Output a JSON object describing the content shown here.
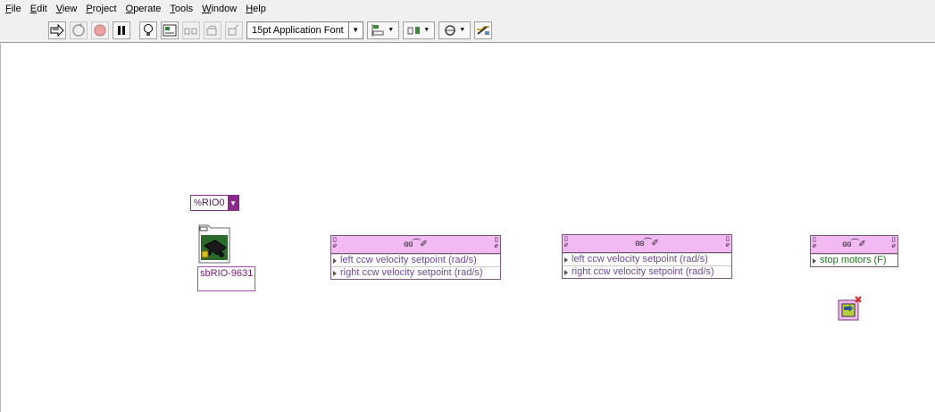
{
  "menu": {
    "items": [
      {
        "label": "File",
        "u": "F",
        "rest": "ile"
      },
      {
        "label": "Edit",
        "u": "E",
        "rest": "dit"
      },
      {
        "label": "View",
        "u": "V",
        "rest": "iew"
      },
      {
        "label": "Project",
        "u": "P",
        "rest": "roject"
      },
      {
        "label": "Operate",
        "u": "O",
        "rest": "perate"
      },
      {
        "label": "Tools",
        "u": "T",
        "rest": "ools"
      },
      {
        "label": "Window",
        "u": "W",
        "rest": "indow"
      },
      {
        "label": "Help",
        "u": "H",
        "rest": "elp"
      }
    ]
  },
  "toolbar": {
    "font_selector": "15pt Application Font"
  },
  "diagram": {
    "resource_control": {
      "prefix": "%",
      "value": "RIO0"
    },
    "device": {
      "label": "sbRIO-9631"
    },
    "property_nodes": [
      {
        "rows": [
          {
            "label": "left ccw velocity setpoint (rad/s)",
            "type": "num"
          },
          {
            "label": "right ccw velocity setpoint (rad/s)",
            "type": "num"
          }
        ]
      },
      {
        "rows": [
          {
            "label": "left ccw velocity setpoint (rad/s)",
            "type": "num"
          },
          {
            "label": "right ccw velocity setpoint (rad/s)",
            "type": "num"
          }
        ]
      },
      {
        "rows": [
          {
            "label": "stop motors (F)",
            "type": "bool"
          }
        ]
      }
    ]
  },
  "colors": {
    "node_header": "#f2b9f2",
    "purple_wire": "#8a2a8a",
    "bool_green": "#1a7a1a"
  }
}
